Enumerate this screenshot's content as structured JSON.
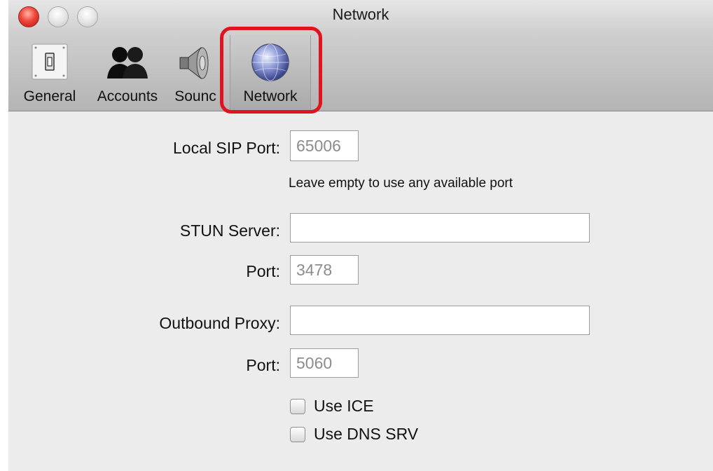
{
  "window": {
    "title": "Network"
  },
  "toolbar": {
    "tabs": [
      {
        "label": "General",
        "icon": "switch-icon"
      },
      {
        "label": "Accounts",
        "icon": "users-icon"
      },
      {
        "label": "Sounc",
        "icon": "speaker-icon"
      },
      {
        "label": "Network",
        "icon": "globe-icon",
        "selected": true
      }
    ],
    "highlight_color": "#e0141e"
  },
  "form": {
    "local_sip_port": {
      "label": "Local SIP Port:",
      "value": "65006",
      "hint": "Leave empty to use any available port"
    },
    "stun_server": {
      "label": "STUN Server:",
      "value": ""
    },
    "stun_port": {
      "label": "Port:",
      "value": "3478"
    },
    "outbound_proxy": {
      "label": "Outbound Proxy:",
      "value": ""
    },
    "proxy_port": {
      "label": "Port:",
      "value": "5060"
    },
    "use_ice": {
      "label": "Use ICE",
      "checked": false
    },
    "use_dns_srv": {
      "label": "Use DNS SRV",
      "checked": false
    }
  }
}
